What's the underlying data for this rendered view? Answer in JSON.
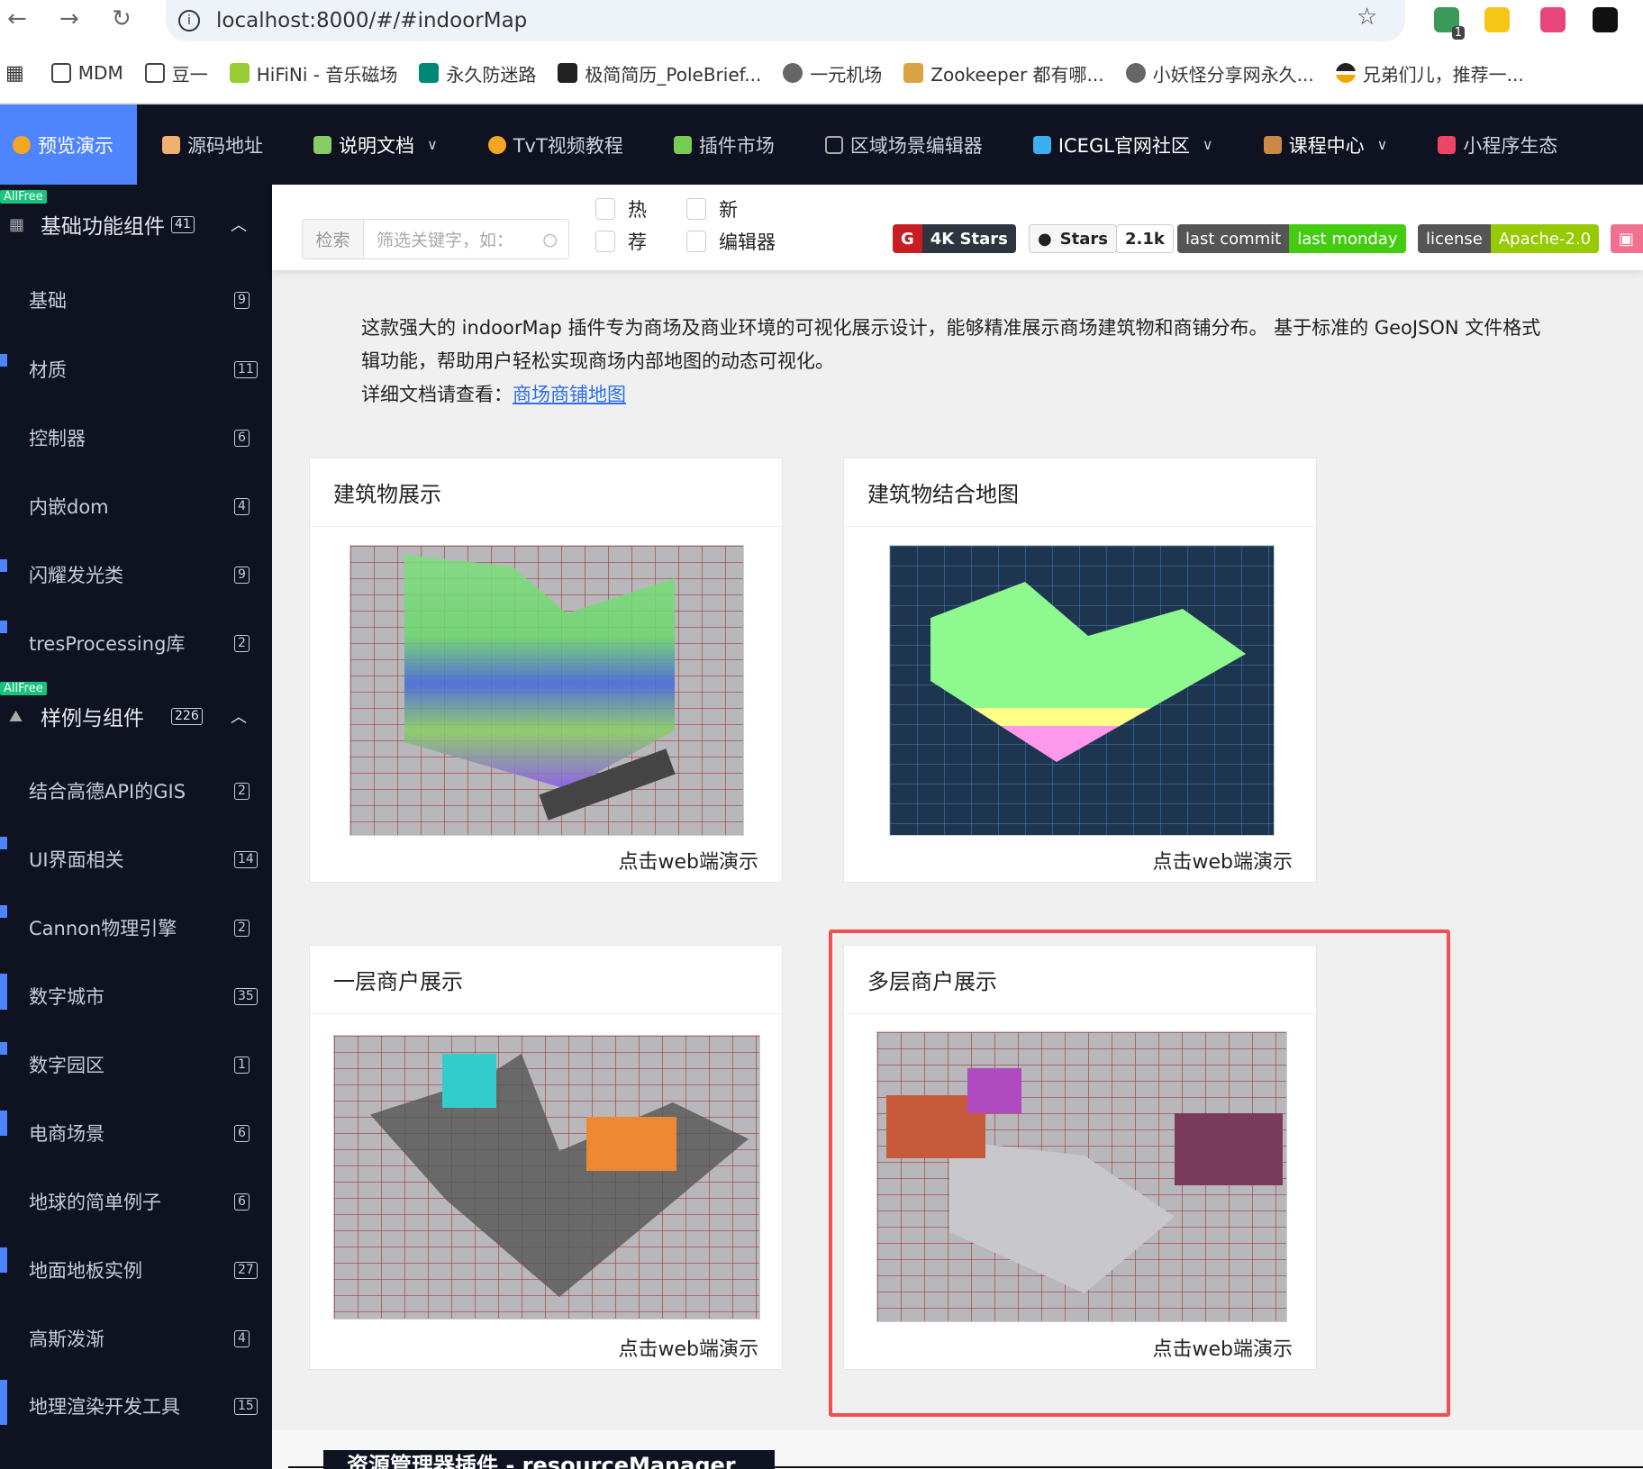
{
  "browser": {
    "url": "localhost:8000/#/#indoorMap",
    "ext_badge": "1",
    "bookmarks": [
      "MDM",
      "豆一",
      "HiFiNi - 音乐磁场",
      "永久防迷路",
      "极简简历_PoleBrief...",
      "一元机场",
      "Zookeeper 都有哪...",
      "小妖怪分享网永久...",
      "兄弟们儿，推荐一..."
    ]
  },
  "nav": {
    "items": [
      {
        "label": "预览演示",
        "active": true
      },
      {
        "label": "源码地址"
      },
      {
        "label": "说明文档",
        "dropdown": true
      },
      {
        "label": "TvT视频教程"
      },
      {
        "label": "插件市场"
      },
      {
        "label": "区域场景编辑器"
      },
      {
        "label": "ICEGL官网社区",
        "dropdown": true
      },
      {
        "label": "课程中心",
        "dropdown": true
      },
      {
        "label": "小程序生态"
      }
    ]
  },
  "sidebar": {
    "groups": [
      {
        "tag": "AllFree",
        "label": "基础功能组件",
        "count": "41",
        "items": [
          {
            "label": "基础",
            "count": "9"
          },
          {
            "label": "材质",
            "count": "11"
          },
          {
            "label": "控制器",
            "count": "6"
          },
          {
            "label": "内嵌dom",
            "count": "4"
          },
          {
            "label": "闪耀发光类",
            "count": "9"
          },
          {
            "label": "tresProcessing库",
            "count": "2"
          }
        ]
      },
      {
        "tag": "AllFree",
        "label": "样例与组件",
        "count": "226",
        "items": [
          {
            "label": "结合高德API的GIS",
            "count": "2"
          },
          {
            "label": "UI界面相关",
            "count": "14"
          },
          {
            "label": "Cannon物理引擎",
            "count": "2"
          },
          {
            "label": "数字城市",
            "count": "35"
          },
          {
            "label": "数字园区",
            "count": "1"
          },
          {
            "label": "电商场景",
            "count": "6"
          },
          {
            "label": "地球的简单例子",
            "count": "6"
          },
          {
            "label": "地面地板实例",
            "count": "27"
          },
          {
            "label": "高斯泼渐",
            "count": "4"
          },
          {
            "label": "地理渲染开发工具",
            "count": "15"
          }
        ]
      }
    ]
  },
  "filter": {
    "search_label": "检索",
    "search_placeholder": "筛选关键字，如：",
    "checkboxes": [
      "热",
      "荐",
      "新",
      "编辑器"
    ]
  },
  "badges": {
    "gitee": "4K Stars",
    "github_label": "Stars",
    "github_count": "2.1k",
    "commit_label": "last commit",
    "commit_value": "last monday",
    "license_label": "license",
    "license_value": "Apache-2.0"
  },
  "description": {
    "line1": "这款强大的 indoorMap 插件专为商场及商业环境的可视化展示设计，能够精准展示商场建筑物和商铺分布。 基于标准的 GeoJSON 文件格式",
    "line2": "辑功能，帮助用户轻松实现商场内部地图的动态可视化。",
    "line3_prefix": "详细文档请查看：",
    "link": "商场商铺地图"
  },
  "cards": [
    {
      "title": "建筑物展示",
      "footer": "点击web端演示"
    },
    {
      "title": "建筑物结合地图",
      "footer": "点击web端演示"
    },
    {
      "title": "一层商户展示",
      "footer": "点击web端演示"
    },
    {
      "title": "多层商户展示",
      "footer": "点击web端演示"
    }
  ],
  "next_section": {
    "title": "资源管理器插件 - resourceManager"
  }
}
